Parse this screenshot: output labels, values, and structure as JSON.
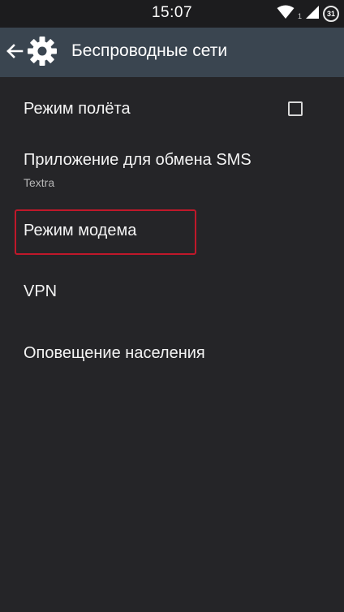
{
  "status_bar": {
    "time": "15:07",
    "sim_indicator": "1",
    "battery_level": "31",
    "icons": [
      "wifi-icon",
      "signal-icon",
      "battery-icon"
    ]
  },
  "action_bar": {
    "title": "Беспроводные сети",
    "back_icon": "back-arrow-icon",
    "app_icon": "gear-icon"
  },
  "settings": {
    "airplane_mode": {
      "label": "Режим полёта",
      "checked": false
    },
    "sms_app": {
      "label": "Приложение для обмена SMS",
      "value": "Textra"
    },
    "tethering": {
      "label": "Режим модема"
    },
    "vpn": {
      "label": "VPN"
    },
    "cell_broadcast": {
      "label": "Оповещение населения"
    }
  },
  "colors": {
    "background": "#252528",
    "action_bar": "#3a4550",
    "status_bar": "#1c1c1e",
    "highlight": "#c0182a"
  }
}
